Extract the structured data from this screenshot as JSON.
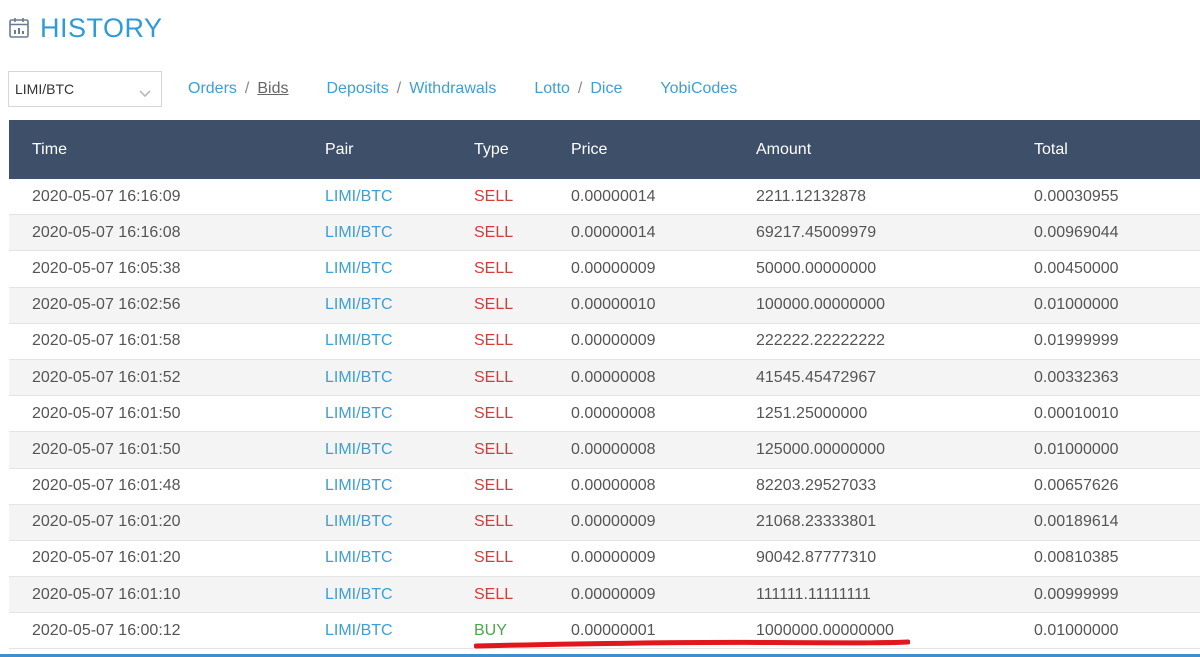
{
  "header": {
    "title": "HISTORY",
    "icon": "calendar-icon"
  },
  "toolbar": {
    "pair_select": {
      "value": "LIMI/BTC"
    },
    "nav": [
      {
        "label": "Orders",
        "active": false
      },
      {
        "label": "Bids",
        "active": true
      },
      {
        "label": "Deposits",
        "active": false
      },
      {
        "label": "Withdrawals",
        "active": false
      },
      {
        "label": "Lotto",
        "active": false
      },
      {
        "label": "Dice",
        "active": false
      },
      {
        "label": "YobiCodes",
        "active": false
      }
    ],
    "separator": "/"
  },
  "table": {
    "columns": [
      "Time",
      "Pair",
      "Type",
      "Price",
      "Amount",
      "Total"
    ],
    "rows": [
      [
        "2020-05-07 16:16:09",
        "LIMI/BTC",
        "SELL",
        "0.00000014",
        "2211.12132878",
        "0.00030955"
      ],
      [
        "2020-05-07 16:16:08",
        "LIMI/BTC",
        "SELL",
        "0.00000014",
        "69217.45009979",
        "0.00969044"
      ],
      [
        "2020-05-07 16:05:38",
        "LIMI/BTC",
        "SELL",
        "0.00000009",
        "50000.00000000",
        "0.00450000"
      ],
      [
        "2020-05-07 16:02:56",
        "LIMI/BTC",
        "SELL",
        "0.00000010",
        "100000.00000000",
        "0.01000000"
      ],
      [
        "2020-05-07 16:01:58",
        "LIMI/BTC",
        "SELL",
        "0.00000009",
        "222222.22222222",
        "0.01999999"
      ],
      [
        "2020-05-07 16:01:52",
        "LIMI/BTC",
        "SELL",
        "0.00000008",
        "41545.45472967",
        "0.00332363"
      ],
      [
        "2020-05-07 16:01:50",
        "LIMI/BTC",
        "SELL",
        "0.00000008",
        "1251.25000000",
        "0.00010010"
      ],
      [
        "2020-05-07 16:01:50",
        "LIMI/BTC",
        "SELL",
        "0.00000008",
        "125000.00000000",
        "0.01000000"
      ],
      [
        "2020-05-07 16:01:48",
        "LIMI/BTC",
        "SELL",
        "0.00000008",
        "82203.29527033",
        "0.00657626"
      ],
      [
        "2020-05-07 16:01:20",
        "LIMI/BTC",
        "SELL",
        "0.00000009",
        "21068.23333801",
        "0.00189614"
      ],
      [
        "2020-05-07 16:01:20",
        "LIMI/BTC",
        "SELL",
        "0.00000009",
        "90042.87777310",
        "0.00810385"
      ],
      [
        "2020-05-07 16:01:10",
        "LIMI/BTC",
        "SELL",
        "0.00000009",
        "111111.11111111",
        "0.00999999"
      ],
      [
        "2020-05-07 16:00:12",
        "LIMI/BTC",
        "BUY",
        "0.00000001",
        "1000000.00000000",
        "0.01000000"
      ]
    ]
  },
  "colors": {
    "accent": "#2f9bd6",
    "header_bg": "#3e5069",
    "sell": "#d23c3c",
    "buy": "#4aa84a",
    "annotation_red": "#e0181e"
  }
}
